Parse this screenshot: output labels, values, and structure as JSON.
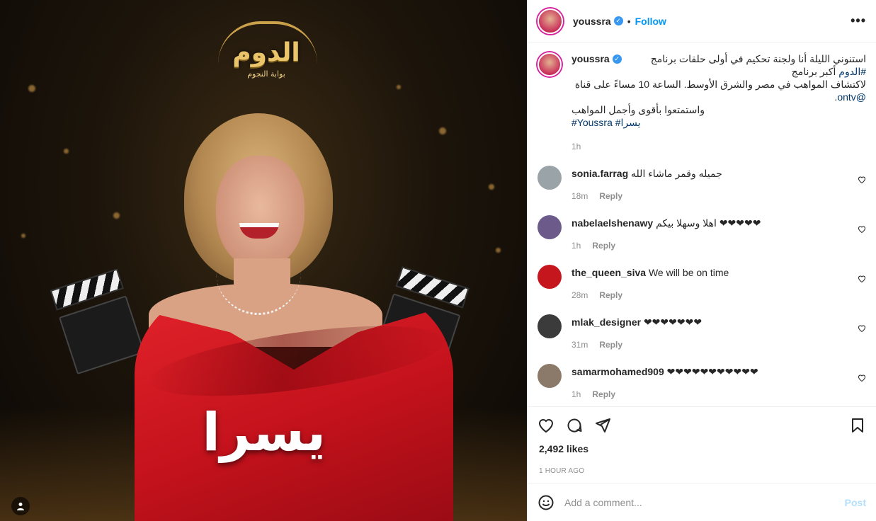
{
  "post": {
    "image": {
      "logo_title": "الدوم",
      "logo_subtitle": "بوابة النجوم",
      "name_overlay": "يسرا",
      "tag_icon": "user-icon"
    },
    "header": {
      "username": "youssra",
      "verified_icon": "verified-badge-icon",
      "separator": "•",
      "follow_label": "Follow",
      "more_icon": "more-options-icon",
      "more_label": "•••"
    },
    "caption": {
      "username": "youssra",
      "line1_before": "استنوني الليلة أنا ولجنة تحكيم في أولى حلقات برنامج ",
      "line1_hashtag": "#الدوم",
      "line1_after": " أكبر برنامج",
      "line2_before": "لاكتشاف المواهب في مصر والشرق الأوسط. الساعة 10 مساءً على قناة ",
      "line2_mention": "@ontv",
      "line2_after": ".",
      "line3": "واستمتعوا بأقوى وأجمل المواهب ",
      "hashtags_en": "#Youssra",
      "hashtags_ar": "#يسرا",
      "time": "1h"
    },
    "comments": [
      {
        "username": "sonia.farrag",
        "text": "جميله وقمر ماشاء الله ",
        "time": "18m",
        "reply": "Reply",
        "avatar_color": "#9aa3a8"
      },
      {
        "username": "nabelaelshenawy",
        "text": "اهلا وسهلا بيكم ❤❤❤❤❤",
        "time": "1h",
        "reply": "Reply",
        "avatar_color": "#6b5a8a"
      },
      {
        "username": "the_queen_siva",
        "text": "We will be on time ",
        "time": "28m",
        "reply": "Reply",
        "avatar_color": "#c4161c"
      },
      {
        "username": "mlak_designer",
        "text": "❤❤❤❤❤❤❤",
        "time": "31m",
        "reply": "Reply",
        "avatar_color": "#3b3b3b"
      },
      {
        "username": "samarmohamed909",
        "text": "❤❤❤❤❤❤❤❤❤❤❤",
        "time": "1h",
        "reply": "Reply",
        "avatar_color": "#8b7a6a"
      }
    ],
    "actions": {
      "like_icon": "heart-icon",
      "comment_icon": "comment-icon",
      "share_icon": "send-icon",
      "save_icon": "bookmark-icon"
    },
    "likes": "2,492 likes",
    "posted_ago": "1 HOUR AGO",
    "add_comment": {
      "emoji_icon": "emoji-icon",
      "placeholder": "Add a comment...",
      "post_label": "Post"
    }
  }
}
